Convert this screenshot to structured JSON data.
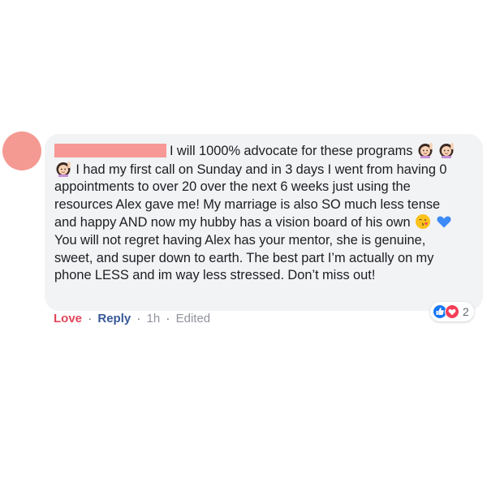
{
  "comment": {
    "author_redaction_color": "#f79897",
    "avatar_color": "#f49a93",
    "text_parts": {
      "p1": "I will 1000% advocate for these programs",
      "p2": "I had my first call on Sunday and in 3 days I went from having 0 appointments to over 20 over the next 6 weeks just using the resources Alex gave me! My marriage is also SO much less tense and happy AND now my hubby has a vision board of his own",
      "p3": "You will not regret having Alex has your mentor, she is genuine, sweet, and super down to earth. The best part I’m actually on my phone LESS and im way less stressed. Don’t miss out!"
    },
    "emojis": [
      "woman-raising-hand-icon",
      "woman-raising-hand-icon",
      "woman-raising-hand-icon",
      "face-blowing-kiss-icon",
      "blue-heart-icon"
    ]
  },
  "actions": {
    "love": "Love",
    "sep1": "·",
    "reply": "Reply",
    "sep2": "·",
    "time": "1h",
    "sep3": "·",
    "edited": "Edited"
  },
  "reactions": {
    "icons": [
      "like-icon",
      "love-icon"
    ],
    "count": "2",
    "like_color": "#1877f2",
    "love_color": "#f33e58"
  }
}
